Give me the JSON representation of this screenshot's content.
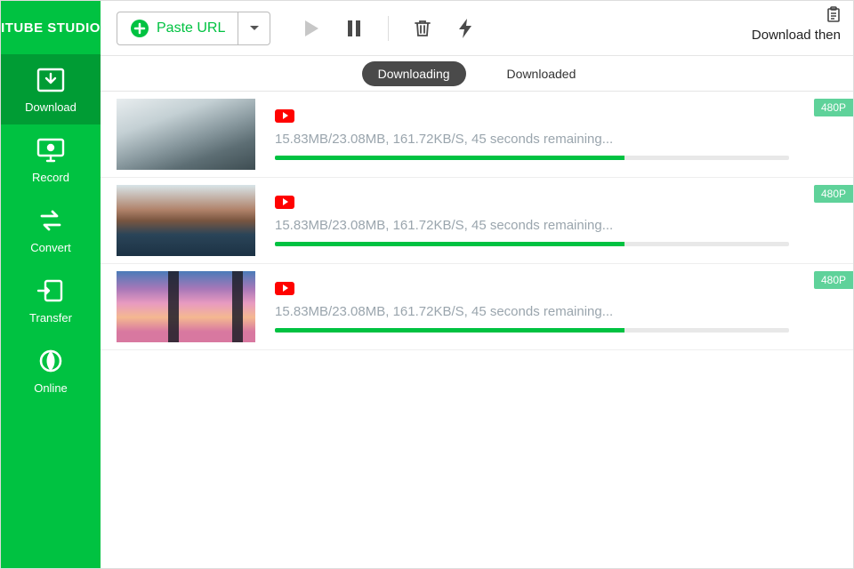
{
  "app": {
    "title": "ITUBE STUDIO"
  },
  "sidebar": {
    "items": [
      {
        "label": "Download"
      },
      {
        "label": "Record"
      },
      {
        "label": "Convert"
      },
      {
        "label": "Transfer"
      },
      {
        "label": "Online"
      }
    ]
  },
  "toolbar": {
    "paste_label": "Paste URL",
    "right_text": "Download then"
  },
  "tabs": {
    "downloading": "Downloading",
    "downloaded": "Downloaded"
  },
  "downloads": [
    {
      "status": "15.83MB/23.08MB, 161.72KB/S, 45 seconds remaining...",
      "quality": "480P",
      "progress": 68
    },
    {
      "status": "15.83MB/23.08MB, 161.72KB/S, 45 seconds remaining...",
      "quality": "480P",
      "progress": 68
    },
    {
      "status": "15.83MB/23.08MB, 161.72KB/S, 45 seconds remaining...",
      "quality": "480P",
      "progress": 68
    }
  ]
}
